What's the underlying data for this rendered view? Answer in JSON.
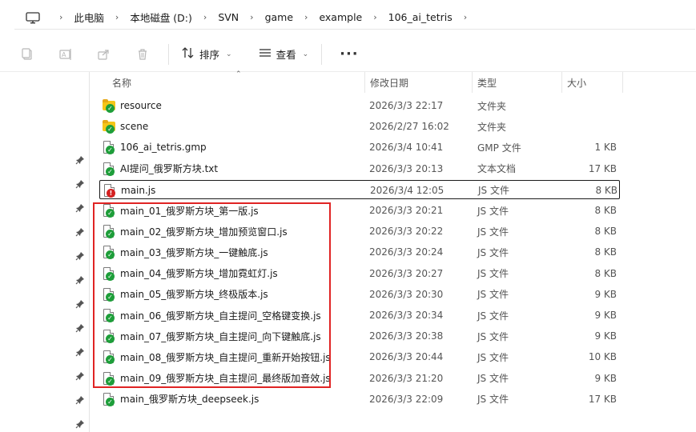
{
  "breadcrumb": [
    "此电脑",
    "本地磁盘 (D:)",
    "SVN",
    "game",
    "example",
    "106_ai_tetris"
  ],
  "toolbar": {
    "sort_label": "排序",
    "view_label": "查看",
    "more_label": "···"
  },
  "columns": {
    "name": "名称",
    "date": "修改日期",
    "type": "类型",
    "size": "大小"
  },
  "files": [
    {
      "name": "resource",
      "date": "2026/3/3 22:17",
      "type": "文件夹",
      "size": "",
      "icon": "folder-icon",
      "status": "ok"
    },
    {
      "name": "scene",
      "date": "2026/2/27 16:02",
      "type": "文件夹",
      "size": "",
      "icon": "folder-icon",
      "status": "ok"
    },
    {
      "name": "106_ai_tetris.gmp",
      "date": "2026/3/4 10:41",
      "type": "GMP 文件",
      "size": "1 KB",
      "icon": "file-icon",
      "status": "ok"
    },
    {
      "name": "AI提问_俄罗斯方块.txt",
      "date": "2026/3/3 20:13",
      "type": "文本文档",
      "size": "17 KB",
      "icon": "file-icon",
      "status": "ok"
    },
    {
      "name": "main.js",
      "date": "2026/3/4 12:05",
      "type": "JS 文件",
      "size": "8 KB",
      "icon": "file-icon",
      "status": "modified"
    },
    {
      "name": "main_01_俄罗斯方块_第一版.js",
      "date": "2026/3/3 20:21",
      "type": "JS 文件",
      "size": "8 KB",
      "icon": "file-icon",
      "status": "ok"
    },
    {
      "name": "main_02_俄罗斯方块_增加预览窗口.js",
      "date": "2026/3/3 20:22",
      "type": "JS 文件",
      "size": "8 KB",
      "icon": "file-icon",
      "status": "ok"
    },
    {
      "name": "main_03_俄罗斯方块_一键触底.js",
      "date": "2026/3/3 20:24",
      "type": "JS 文件",
      "size": "8 KB",
      "icon": "file-icon",
      "status": "ok"
    },
    {
      "name": "main_04_俄罗斯方块_增加霓虹灯.js",
      "date": "2026/3/3 20:27",
      "type": "JS 文件",
      "size": "8 KB",
      "icon": "file-icon",
      "status": "ok"
    },
    {
      "name": "main_05_俄罗斯方块_终极版本.js",
      "date": "2026/3/3 20:30",
      "type": "JS 文件",
      "size": "9 KB",
      "icon": "file-icon",
      "status": "ok"
    },
    {
      "name": "main_06_俄罗斯方块_自主提问_空格键变换.js",
      "date": "2026/3/3 20:34",
      "type": "JS 文件",
      "size": "9 KB",
      "icon": "file-icon",
      "status": "ok"
    },
    {
      "name": "main_07_俄罗斯方块_自主提问_向下键触底.js",
      "date": "2026/3/3 20:38",
      "type": "JS 文件",
      "size": "9 KB",
      "icon": "file-icon",
      "status": "ok"
    },
    {
      "name": "main_08_俄罗斯方块_自主提问_重新开始按钮.js",
      "date": "2026/3/3 20:44",
      "type": "JS 文件",
      "size": "10 KB",
      "icon": "file-icon",
      "status": "ok"
    },
    {
      "name": "main_09_俄罗斯方块_自主提问_最终版加音效.js",
      "date": "2026/3/3 21:20",
      "type": "JS 文件",
      "size": "9 KB",
      "icon": "file-icon",
      "status": "ok"
    },
    {
      "name": "main_俄罗斯方块_deepseek.js",
      "date": "2026/3/3 22:09",
      "type": "JS 文件",
      "size": "17 KB",
      "icon": "file-icon",
      "status": "ok"
    }
  ],
  "colors": {
    "highlight_box": "#e02424",
    "ok_badge": "#1e9e3a",
    "modified_badge": "#d42020",
    "folder": "#f5c518"
  }
}
